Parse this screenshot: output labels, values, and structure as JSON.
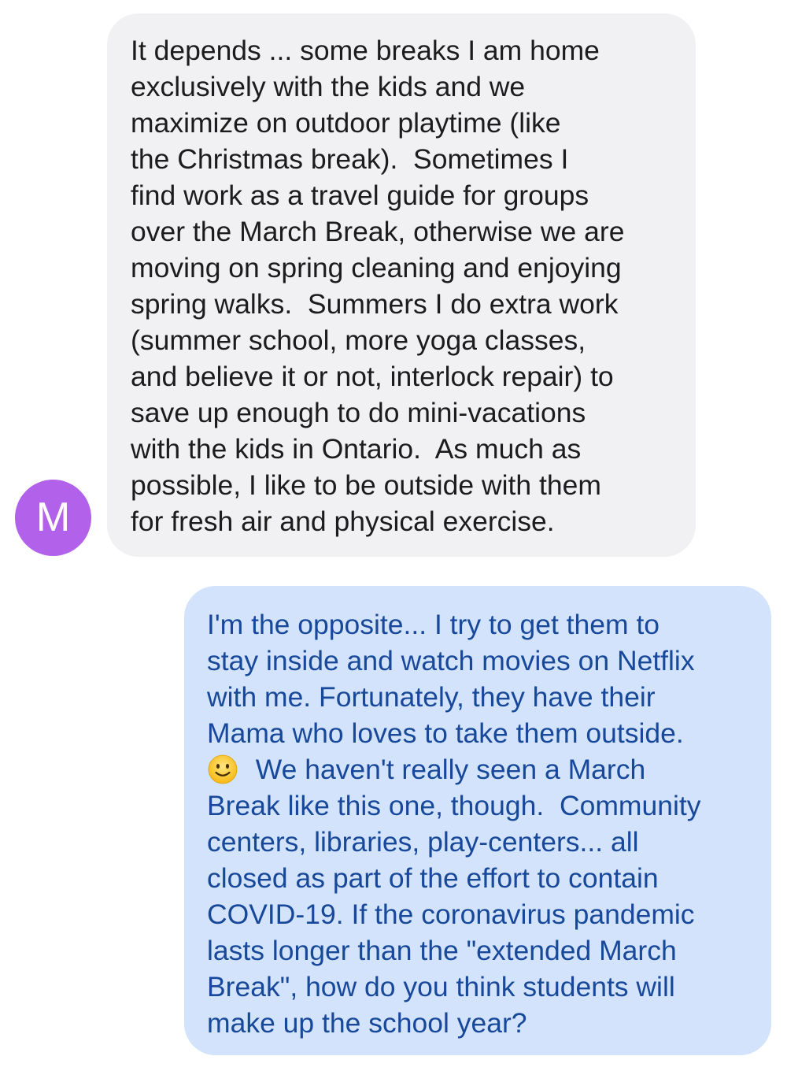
{
  "conversation": {
    "incoming": {
      "avatar_initial": "M",
      "lines": [
        "It depends ... some breaks I am home",
        "exclusively with the kids and we",
        "maximize on outdoor playtime (like",
        "the Christmas break).  Sometimes I",
        "find work as a travel guide for groups",
        "over the March Break, otherwise we are",
        "moving on spring cleaning and enjoying",
        "spring walks.  Summers I do extra work",
        "(summer school, more yoga classes,",
        "and believe it or not, interlock repair) to",
        "save up enough to do mini-vacations",
        "with the kids in Ontario.  As much as",
        "possible, I like to be outside with them",
        "for fresh air and physical exercise."
      ]
    },
    "outgoing": {
      "lines": [
        "I'm the opposite... I try to get them to",
        "stay inside and watch movies on Netflix",
        "with me. Fortunately, they have their",
        "Mama who loves to take them outside."
      ],
      "emoji_icon": "slightly-smiling-face-icon",
      "emoji_line_text": "  We haven't really seen a March",
      "lines_after": [
        "Break like this one, though.  Community",
        "centers, libraries, play-centers... all",
        "closed as part of the effort to contain",
        "COVID-19. If the coronavirus pandemic",
        "lasts longer than the \"extended March",
        "Break\", how do you think students will",
        "make up the school year?"
      ]
    }
  },
  "colors": {
    "incoming_bubble": "#f1f1f4",
    "outgoing_bubble": "#d2e3fb",
    "incoming_text": "#1c1c1c",
    "outgoing_text": "#17489a",
    "avatar": "#b161ea"
  }
}
